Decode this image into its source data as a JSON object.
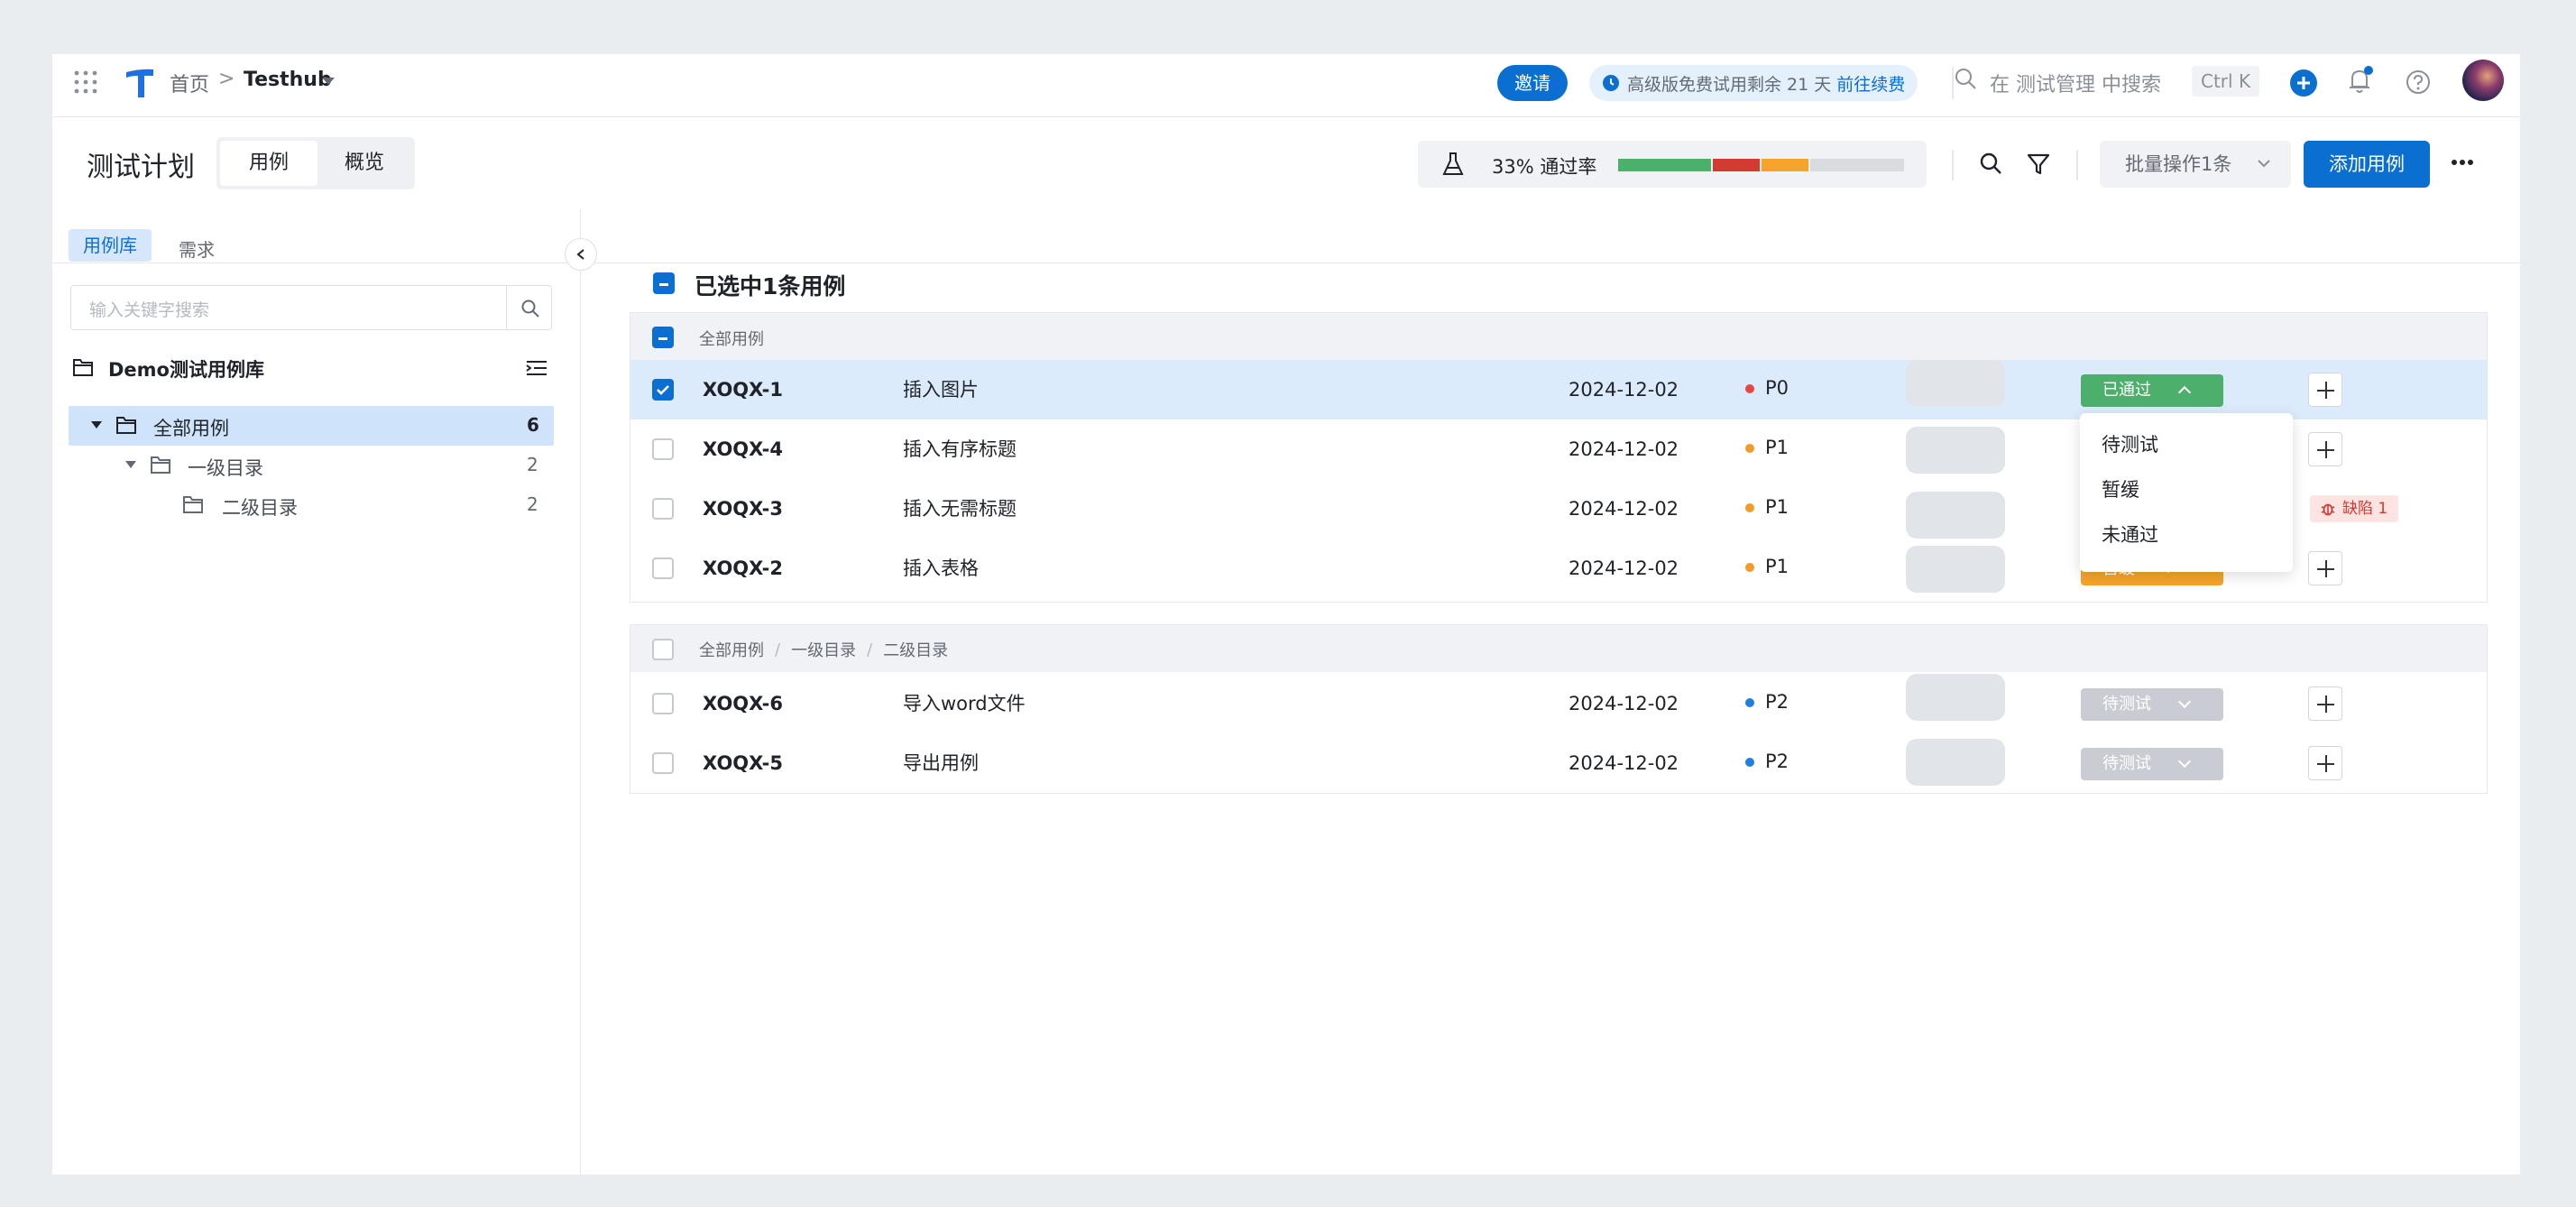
{
  "topbar": {
    "breadcrumb_home": "首页",
    "breadcrumb_sep": ">",
    "project": "Testhub",
    "invite": "邀请",
    "trial_text": "高级版免费试用剩余 21 天",
    "trial_link": "前往续费",
    "search_placeholder": "在 测试管理 中搜索",
    "shortcut": "Ctrl K"
  },
  "header": {
    "title": "测试计划",
    "tabs": [
      "用例",
      "概览"
    ],
    "pass_rate": "33% 通过率",
    "batch_label": "批量操作1条",
    "add_case": "添加用例",
    "progress": {
      "passed": 0.33,
      "failed": 0.167,
      "blocked": 0.167,
      "pending": 0.333
    }
  },
  "sidebar": {
    "tabs": [
      "用例库",
      "需求"
    ],
    "search_placeholder": "输入关键字搜索",
    "library": "Demo测试用例库",
    "tree": [
      {
        "label": "全部用例",
        "count": "6"
      },
      {
        "label": "一级目录",
        "count": "2"
      },
      {
        "label": "二级目录",
        "count": "2"
      }
    ]
  },
  "main": {
    "selection_title": "已选中1条用例",
    "group1": {
      "path": "全部用例",
      "rows": [
        {
          "id": "XOQX-1",
          "title": "插入图片",
          "date": "2024-12-02",
          "priority": "P0",
          "status": "已通过"
        },
        {
          "id": "XOQX-4",
          "title": "插入有序标题",
          "date": "2024-12-02",
          "priority": "P1",
          "status": ""
        },
        {
          "id": "XOQX-3",
          "title": "插入无需标题",
          "date": "2024-12-02",
          "priority": "P1",
          "status": "",
          "defect": "缺陷 1"
        },
        {
          "id": "XOQX-2",
          "title": "插入表格",
          "date": "2024-12-02",
          "priority": "P1",
          "status": "暂缓"
        }
      ]
    },
    "group2": {
      "path": [
        "全部用例",
        "一级目录",
        "二级目录"
      ],
      "sep": "/",
      "rows": [
        {
          "id": "XOQX-6",
          "title": "导入word文件",
          "date": "2024-12-02",
          "priority": "P2",
          "status": "待测试"
        },
        {
          "id": "XOQX-5",
          "title": "导出用例",
          "date": "2024-12-02",
          "priority": "P2",
          "status": "待测试"
        }
      ]
    },
    "dropdown": [
      "待测试",
      "暂缓",
      "未通过"
    ]
  },
  "colors": {
    "accent": "#0b6fd1",
    "passed": "#4caf6b",
    "failed": "#d23a32",
    "blocked": "#f5a32a",
    "pending": "#c9cdd3",
    "p0": "#e5483f",
    "p1": "#f39a2b",
    "p2": "#1f7fe0"
  },
  "icons": [
    "apps-grid-icon",
    "logo-icon",
    "chevron-right-icon",
    "caret-down-icon",
    "clock-icon",
    "search-icon",
    "plus-circle-icon",
    "bell-icon",
    "help-icon",
    "avatar",
    "flask-icon",
    "filter-icon",
    "more-icon",
    "collapse-icon",
    "folder-icon",
    "list-settings-icon",
    "bug-icon"
  ]
}
